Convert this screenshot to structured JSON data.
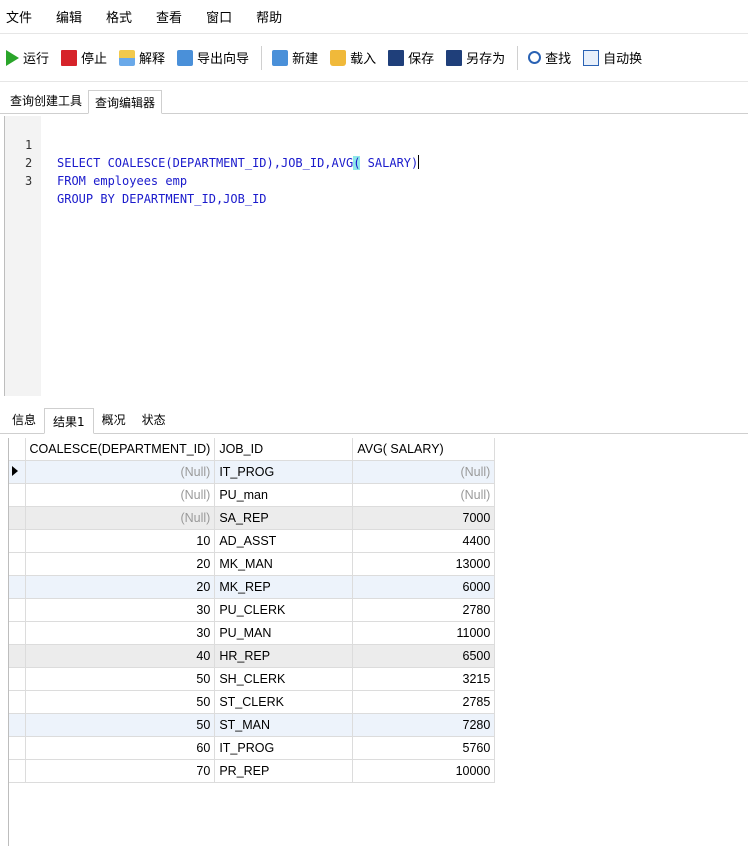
{
  "menubar": [
    "文件",
    "编辑",
    "格式",
    "查看",
    "窗口",
    "帮助"
  ],
  "toolbar": {
    "run": "运行",
    "stop": "停止",
    "explain": "解释",
    "export_wizard": "导出向导",
    "new": "新建",
    "load": "载入",
    "save": "保存",
    "save_as": "另存为",
    "find": "查找",
    "auto_wrap": "自动换"
  },
  "top_tabs": [
    "查询创建工具",
    "查询编辑器"
  ],
  "editor": {
    "lines": [
      {
        "num": "1",
        "text_before": "SELECT COALESCE(DEPARTMENT_ID),JOB_ID,AVG",
        "highlight": "(",
        "text_after": " SALARY)"
      },
      {
        "num": "2",
        "text_before": "FROM employees emp",
        "highlight": "",
        "text_after": ""
      },
      {
        "num": "3",
        "text_before": "GROUP BY DEPARTMENT_ID,JOB_ID",
        "highlight": "",
        "text_after": ""
      }
    ]
  },
  "bottom_tabs": [
    "信息",
    "结果1",
    "概况",
    "状态"
  ],
  "results": {
    "columns": [
      "COALESCE(DEPARTMENT_ID)",
      "JOB_ID",
      "AVG( SALARY)"
    ],
    "rows": [
      [
        "(Null)",
        "IT_PROG",
        "(Null)"
      ],
      [
        "(Null)",
        "PU_man",
        "(Null)"
      ],
      [
        "(Null)",
        "SA_REP",
        "7000"
      ],
      [
        "10",
        "AD_ASST",
        "4400"
      ],
      [
        "20",
        "MK_MAN",
        "13000"
      ],
      [
        "20",
        "MK_REP",
        "6000"
      ],
      [
        "30",
        "PU_CLERK",
        "2780"
      ],
      [
        "30",
        "PU_MAN",
        "11000"
      ],
      [
        "40",
        "HR_REP",
        "6500"
      ],
      [
        "50",
        "SH_CLERK",
        "3215"
      ],
      [
        "50",
        "ST_CLERK",
        "2785"
      ],
      [
        "50",
        "ST_MAN",
        "7280"
      ],
      [
        "60",
        "IT_PROG",
        "5760"
      ],
      [
        "70",
        "PR_REP",
        "10000"
      ]
    ]
  }
}
